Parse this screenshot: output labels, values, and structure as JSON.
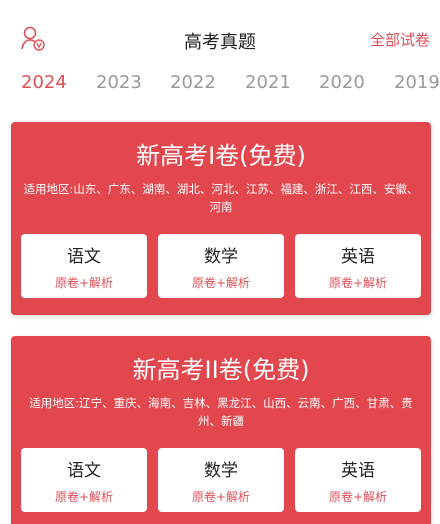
{
  "header": {
    "title": "高考真题",
    "all_papers": "全部试卷",
    "user_icon": "user-icon"
  },
  "years": [
    "2024",
    "2023",
    "2022",
    "2021",
    "2020",
    "2019"
  ],
  "active_year": "2024",
  "cards": [
    {
      "title": "新高考I卷(免费)",
      "region": "适用地区:山东、广东、湖南、湖北、河北、江苏、福建、浙江、江西、安徽、河南",
      "subjects": [
        {
          "name": "语文",
          "sub": "原卷+解析"
        },
        {
          "name": "数学",
          "sub": "原卷+解析"
        },
        {
          "name": "英语",
          "sub": "原卷+解析"
        }
      ]
    },
    {
      "title": "新高考II卷(免费)",
      "region": "适用地区:辽宁、重庆、海南、吉林、黑龙江、山西、云南、广西、甘肃、贵州、新疆",
      "subjects": [
        {
          "name": "语文",
          "sub": "原卷+解析"
        },
        {
          "name": "数学",
          "sub": "原卷+解析"
        },
        {
          "name": "英语",
          "sub": "原卷+解析"
        }
      ]
    }
  ],
  "colors": {
    "accent": "#e0505a",
    "card": "#e2474e"
  }
}
